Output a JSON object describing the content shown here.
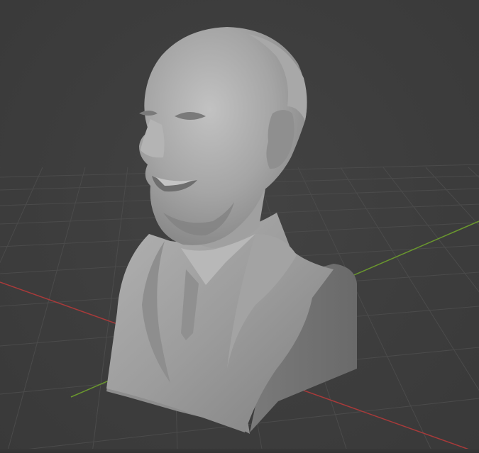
{
  "viewport": {
    "background_color": "#3d3d3d",
    "grid_color": "#4a4a4a",
    "x_axis_color": "#b23b3b",
    "y_axis_color": "#6e9b2f",
    "model_color": "#9a9a9a",
    "model": "bust-sculpture"
  }
}
